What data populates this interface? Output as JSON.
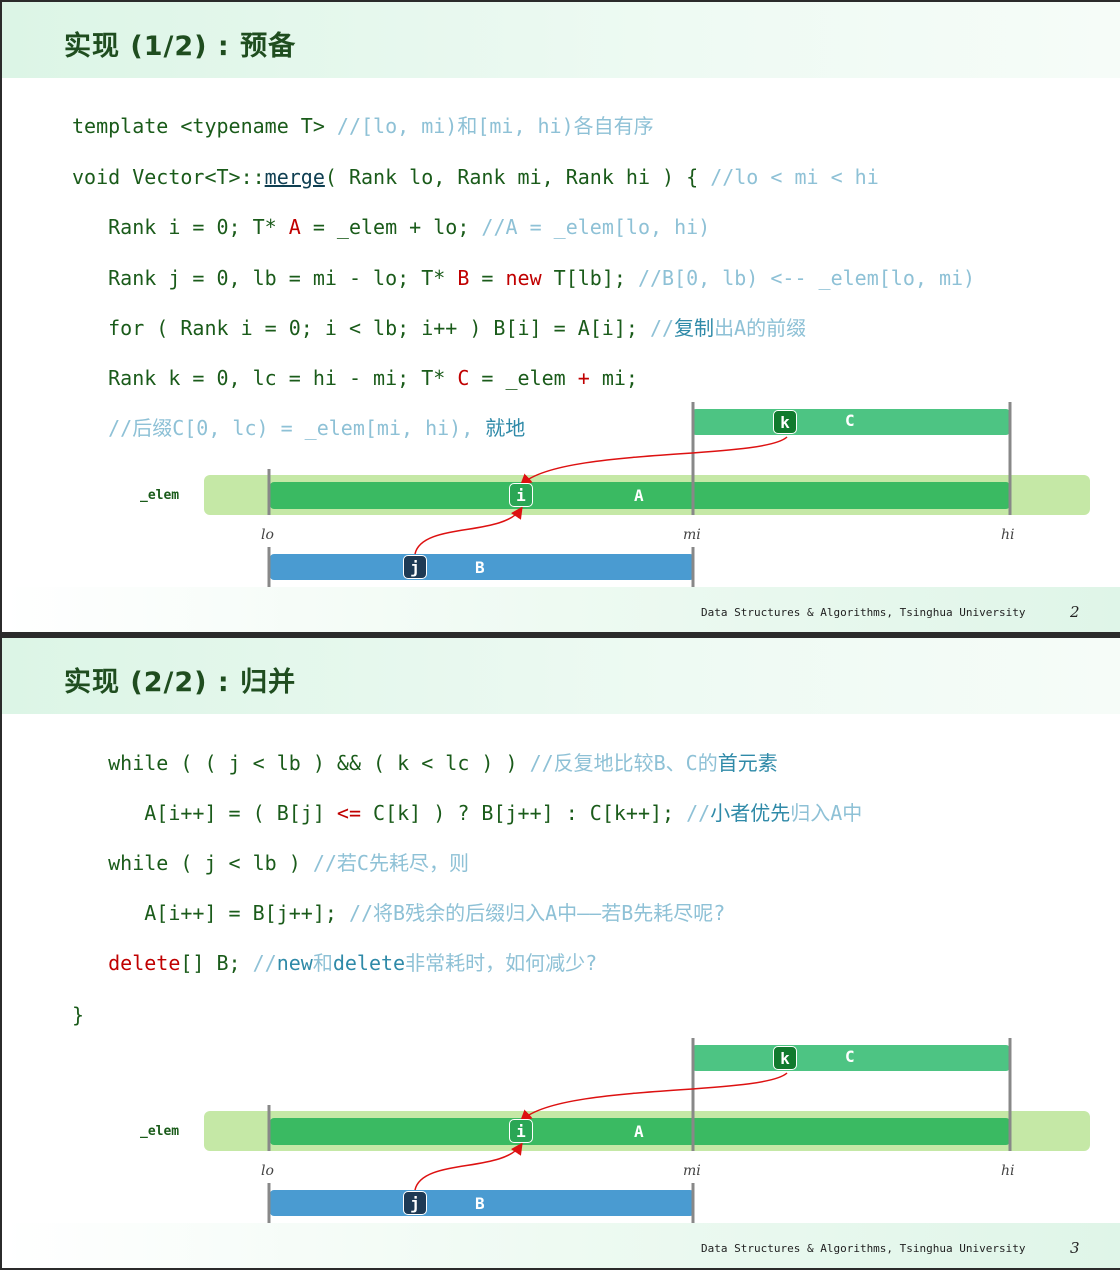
{
  "slides": [
    {
      "title": "实现 (1/2) : 预备",
      "footer": "Data Structures & Algorithms, Tsinghua University",
      "page": "2",
      "code": [
        {
          "parts": [
            [
              "template <typename T> ",
              "code"
            ],
            [
              "//[lo, mi)和[mi, hi)各自有序",
              "cmt"
            ]
          ]
        },
        {
          "parts": [
            [
              "void Vector<T>::",
              "code"
            ],
            [
              "merge",
              "dark"
            ],
            [
              "( Rank lo, Rank mi, Rank hi ) { ",
              "code"
            ],
            [
              "//lo < mi < hi",
              "cmt"
            ]
          ]
        },
        {
          "parts": [
            [
              "   Rank i = 0; T* ",
              "code"
            ],
            [
              "A",
              "red"
            ],
            [
              " = _elem + lo; ",
              "code"
            ],
            [
              "//A = _elem[lo, hi)",
              "cmt"
            ]
          ]
        },
        {
          "parts": [
            [
              "   Rank j = 0, lb = mi - lo; T* ",
              "code"
            ],
            [
              "B",
              "red"
            ],
            [
              " = ",
              "code"
            ],
            [
              "new",
              "red"
            ],
            [
              " T[lb]; ",
              "code"
            ],
            [
              "//B[0, lb) <-- _elem[lo, mi)",
              "cmt"
            ]
          ]
        },
        {
          "parts": [
            [
              "   for ( Rank i = 0; i < lb; i++ ) B[i] = A[i]; ",
              "code"
            ],
            [
              "//",
              "cmt"
            ],
            [
              "复制",
              "cmt-d"
            ],
            [
              "出A的前缀",
              "cmt"
            ]
          ]
        },
        {
          "parts": [
            [
              "   Rank k = 0, lc = hi - mi; T* ",
              "code"
            ],
            [
              "C",
              "red"
            ],
            [
              " = _elem ",
              "code"
            ],
            [
              "+",
              "red"
            ],
            [
              " mi;",
              "code"
            ]
          ]
        },
        {
          "parts": [
            [
              "   //后缀C[0, lc) = _elem[mi, hi), ",
              "cmt"
            ],
            [
              "就地",
              "cmt-d"
            ]
          ]
        }
      ]
    },
    {
      "title": "实现 (2/2) : 归并",
      "footer": "Data Structures & Algorithms, Tsinghua University",
      "page": "3",
      "code": [
        {
          "parts": [
            [
              "   while ( ( j < lb ) && ( k < lc ) ) ",
              "code"
            ],
            [
              "//反复地比较B、C的",
              "cmt"
            ],
            [
              "首元素",
              "cmt-d"
            ]
          ]
        },
        {
          "parts": [
            [
              "      A[i++] = ( B[j] ",
              "code"
            ],
            [
              "<=",
              "red"
            ],
            [
              " C[k] ) ? B[j++] : C[k++]; ",
              "code"
            ],
            [
              "//",
              "cmt"
            ],
            [
              "小者优先",
              "cmt-d"
            ],
            [
              "归入A中",
              "cmt"
            ]
          ]
        },
        {
          "parts": [
            [
              "   while ( j < lb ) ",
              "code"
            ],
            [
              "//若C先耗尽，则",
              "cmt"
            ]
          ]
        },
        {
          "parts": [
            [
              "      A[i++] = B[j++]; ",
              "code"
            ],
            [
              "//将B残余的后缀归入A中——若B先耗尽呢?",
              "cmt"
            ]
          ]
        },
        {
          "parts": [
            [
              "   ",
              "code"
            ],
            [
              "delete",
              "red"
            ],
            [
              "[] B; ",
              "code"
            ],
            [
              "//",
              "cmt"
            ],
            [
              "new",
              "cmt-d"
            ],
            [
              "和",
              "cmt"
            ],
            [
              "delete",
              "cmt-d"
            ],
            [
              "非常耗时，如何减少?",
              "cmt"
            ]
          ]
        },
        {
          "parts": [
            [
              "}",
              "code"
            ]
          ]
        }
      ]
    }
  ],
  "diagram": {
    "elem_label": "_elem",
    "axis": {
      "lo": "lo",
      "mi": "mi",
      "hi": "hi"
    },
    "bars": {
      "A": "A",
      "B": "B",
      "C": "C"
    },
    "pointers": {
      "i": "i",
      "j": "j",
      "k": "k"
    },
    "colors": {
      "elem_bg": "#c5e8a6",
      "A": "#3aba62",
      "B": "#4a9bd1",
      "C": "#4dc483",
      "ptr_i": "#2aa655",
      "ptr_j": "#1e3a55",
      "ptr_k": "#117a2e",
      "arrow": "#dd1111"
    }
  }
}
